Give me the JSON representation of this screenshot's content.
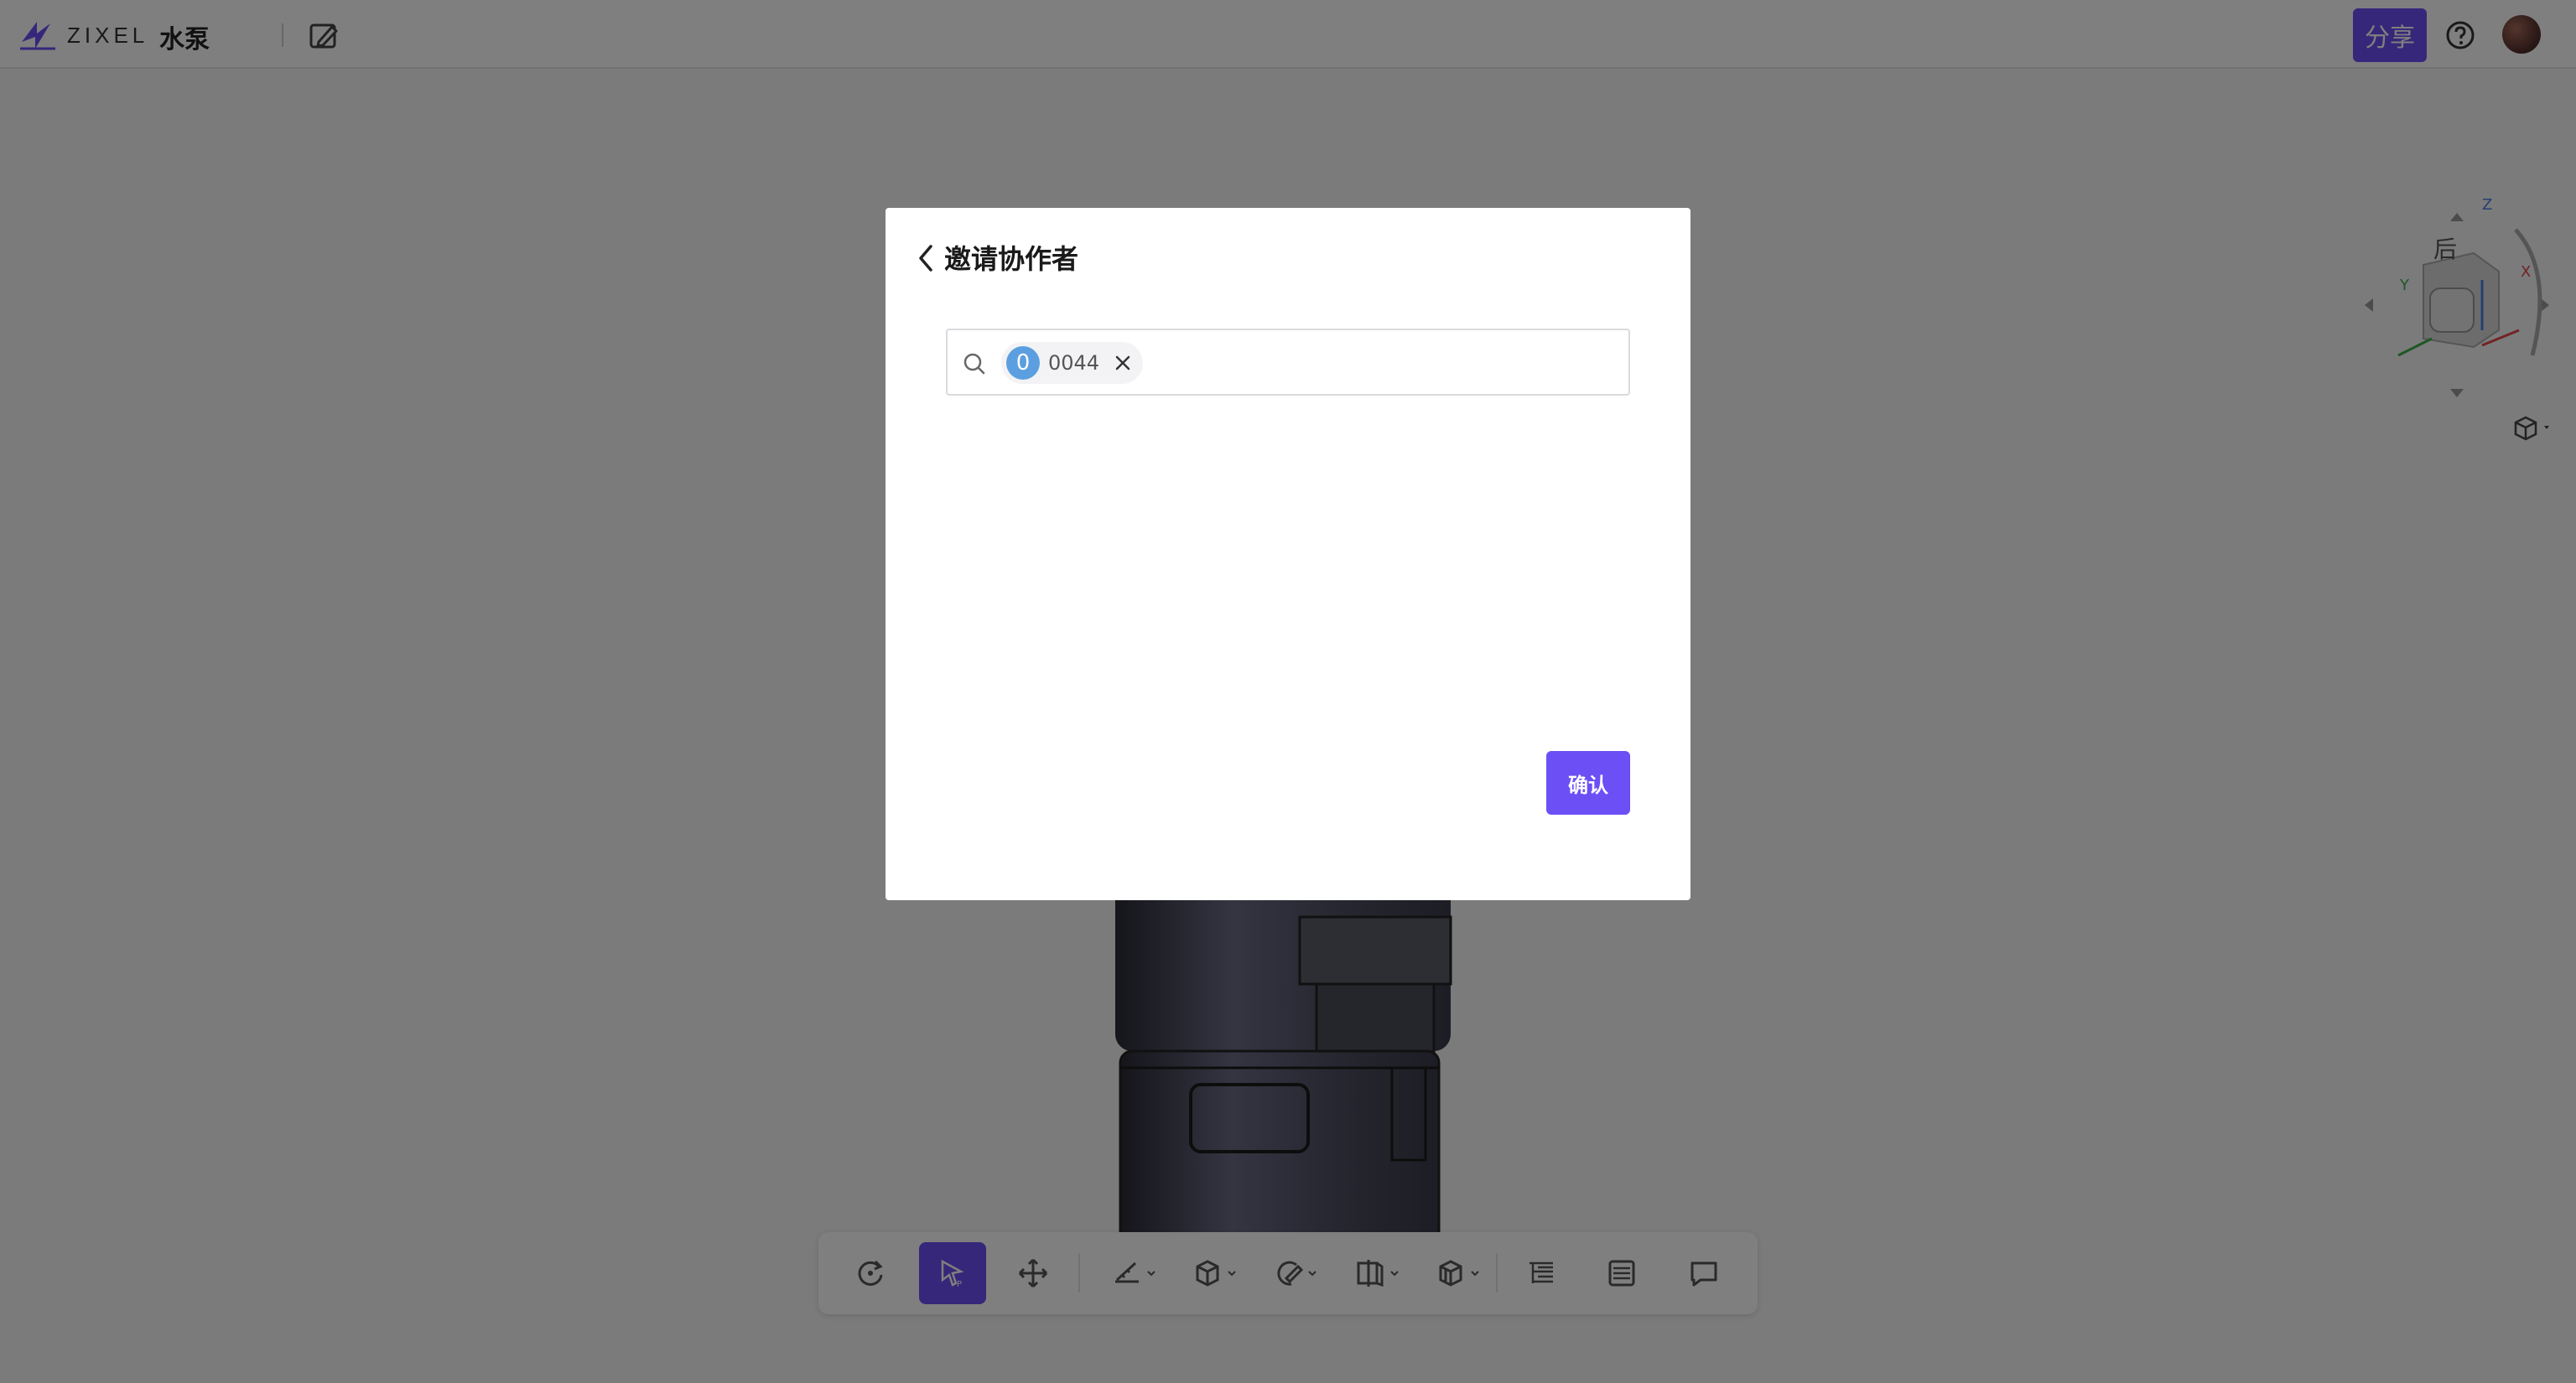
{
  "header": {
    "logo_text": "ZIXEL",
    "doc_title": "水泵",
    "share_label": "分享"
  },
  "viewcube": {
    "face_label": "后",
    "axis_x": "X",
    "axis_y": "Y",
    "axis_z": "Z"
  },
  "toolbar": {
    "tools": [
      {
        "name": "rotate",
        "icon": "rotate-icon"
      },
      {
        "name": "select",
        "icon": "select-cursor-icon",
        "active": true
      },
      {
        "name": "pan",
        "icon": "move-icon"
      },
      {
        "name": "measure",
        "icon": "measure-icon",
        "dropdown": true
      },
      {
        "name": "explode",
        "icon": "cube-explode-icon",
        "dropdown": true
      },
      {
        "name": "markup",
        "icon": "markup-icon",
        "dropdown": true
      },
      {
        "name": "section",
        "icon": "section-icon",
        "dropdown": true
      },
      {
        "name": "display",
        "icon": "cube-display-icon",
        "dropdown": true
      },
      {
        "name": "structure-tree",
        "icon": "tree-icon"
      },
      {
        "name": "properties",
        "icon": "list-icon"
      },
      {
        "name": "comments",
        "icon": "comment-icon"
      }
    ]
  },
  "modal": {
    "title": "邀请协作者",
    "chip": {
      "initial": "0",
      "name": "0044"
    },
    "confirm_label": "确认"
  },
  "colors": {
    "accent": "#6c4ff5",
    "chip_avatar": "#5b9fe0",
    "overlay": "rgba(0,0,0,0.5)"
  }
}
